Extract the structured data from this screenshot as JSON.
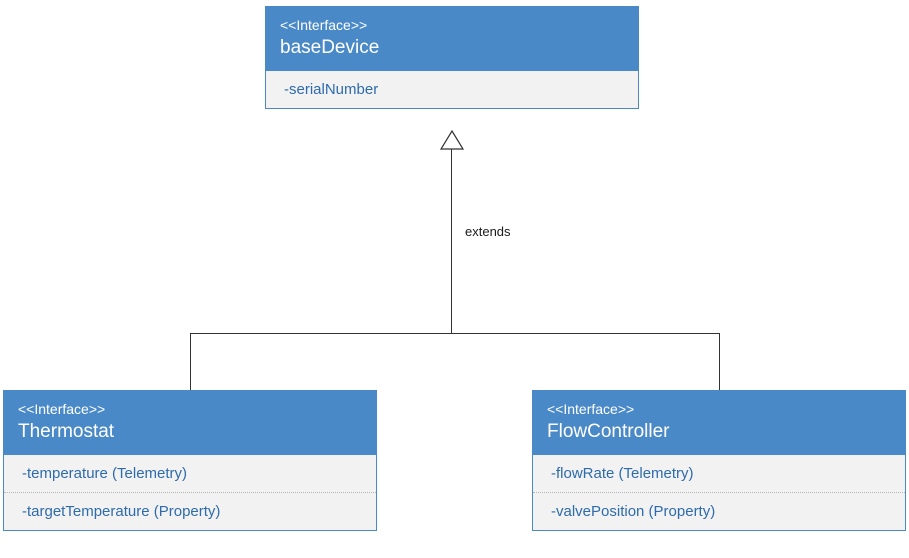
{
  "base": {
    "stereotype": "<<Interface>>",
    "name": "baseDevice",
    "attrs": [
      "-serialNumber"
    ]
  },
  "left": {
    "stereotype": "<<Interface>>",
    "name": "Thermostat",
    "attrs": [
      "-temperature (Telemetry)",
      "-targetTemperature (Property)"
    ]
  },
  "right": {
    "stereotype": "<<Interface>>",
    "name": "FlowController",
    "attrs": [
      "-flowRate (Telemetry)",
      "-valvePosition (Property)"
    ]
  },
  "relationship": {
    "label": "extends"
  }
}
